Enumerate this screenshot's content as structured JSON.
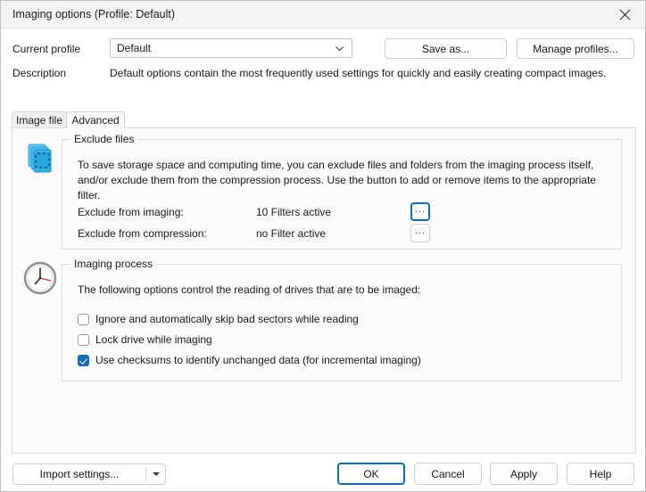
{
  "window": {
    "title": "Imaging options (Profile: Default)",
    "close_icon": "close-icon"
  },
  "header": {
    "current_profile_label": "Current profile",
    "profile_combo": {
      "value": "Default",
      "arrow_icon": "chevron-down-icon"
    },
    "save_as_label": "Save as...",
    "manage_profiles_label": "Manage profiles...",
    "description_label": "Description",
    "description_text": "Default options contain the most frequently used settings for quickly and easily creating compact images."
  },
  "tabs": [
    {
      "label": "Image file",
      "selected": false
    },
    {
      "label": "Advanced",
      "selected": true
    }
  ],
  "groups": {
    "exclude_files": {
      "icon": "file-stack-icon",
      "title": "Exclude files",
      "description": "To save storage space and computing time, you can exclude files and folders from the imaging process itself, and/or exclude them from the compression process. Use the button to add or remove items to the appropriate filter.",
      "rows": [
        {
          "label": "Exclude from imaging:",
          "value": "10 Filters active",
          "button_label": "...",
          "focused": true
        },
        {
          "label": "Exclude from compression:",
          "value": "no Filter active",
          "button_label": "...",
          "focused": false
        }
      ]
    },
    "imaging_process": {
      "icon": "clock-icon",
      "title": "Imaging process",
      "description": "The following options control the reading of drives that are to be imaged:",
      "checkboxes": [
        {
          "label": "Ignore and automatically skip bad sectors while reading",
          "checked": false
        },
        {
          "label": "Lock drive while imaging",
          "checked": false
        },
        {
          "label": "Use checksums to identify unchanged data (for incremental imaging)",
          "checked": true
        }
      ]
    }
  },
  "footer": {
    "import_settings_label": "Import settings...",
    "import_settings_arrow_icon": "caret-down-icon",
    "ok_label": "OK",
    "cancel_label": "Cancel",
    "apply_label": "Apply",
    "help_label": "Help"
  },
  "colors": {
    "accent": "#0f6cbd",
    "title_bar": "#f3f3f3",
    "panel": "#fafafa",
    "border": "#dcdcdc"
  }
}
